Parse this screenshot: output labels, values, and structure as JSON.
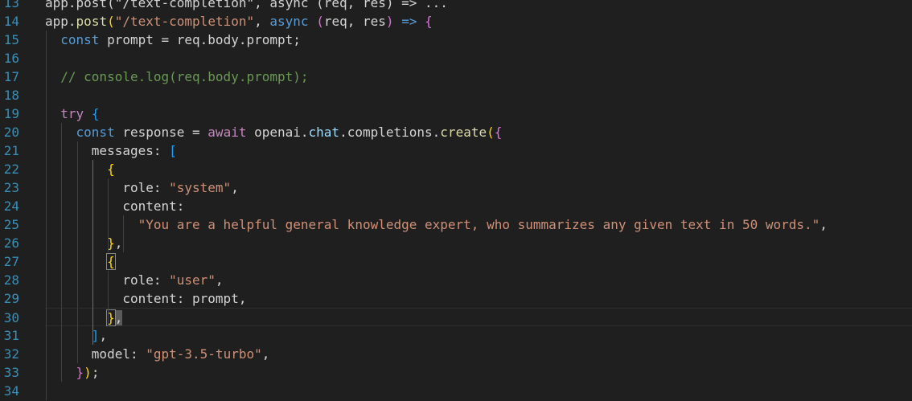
{
  "editor": {
    "lines": [
      {
        "num": "13",
        "tokens": [
          {
            "t": "app.post",
            "c": "t-plain"
          },
          {
            "t": "(\"/text-completion\", async (req, res) => ...",
            "c": "t-plain"
          }
        ]
      },
      {
        "num": "14",
        "tokens": [
          {
            "t": "app",
            "c": "t-plain"
          },
          {
            "t": ".",
            "c": "t-plain"
          },
          {
            "t": "post",
            "c": "t-func"
          },
          {
            "t": "(",
            "c": "t-paren1"
          },
          {
            "t": "\"/text-completion\"",
            "c": "t-string"
          },
          {
            "t": ", ",
            "c": "t-plain"
          },
          {
            "t": "async",
            "c": "t-keyword"
          },
          {
            "t": " ",
            "c": "t-plain"
          },
          {
            "t": "(",
            "c": "t-paren2"
          },
          {
            "t": "req",
            "c": "t-plain"
          },
          {
            "t": ", ",
            "c": "t-plain"
          },
          {
            "t": "res",
            "c": "t-plain"
          },
          {
            "t": ")",
            "c": "t-paren2"
          },
          {
            "t": " ",
            "c": "t-plain"
          },
          {
            "t": "=>",
            "c": "t-keyword"
          },
          {
            "t": " ",
            "c": "t-plain"
          },
          {
            "t": "{",
            "c": "t-paren2"
          }
        ]
      },
      {
        "num": "15",
        "tokens": [
          {
            "t": "  ",
            "c": "t-plain"
          },
          {
            "t": "const",
            "c": "t-keyword"
          },
          {
            "t": " prompt = req.",
            "c": "t-plain"
          },
          {
            "t": "body",
            "c": "t-plain"
          },
          {
            "t": ".prompt;",
            "c": "t-plain"
          }
        ]
      },
      {
        "num": "16",
        "tokens": []
      },
      {
        "num": "17",
        "tokens": [
          {
            "t": "  ",
            "c": "t-plain"
          },
          {
            "t": "// console.log(req.body.prompt);",
            "c": "t-comment"
          }
        ]
      },
      {
        "num": "18",
        "tokens": []
      },
      {
        "num": "19",
        "tokens": [
          {
            "t": "  ",
            "c": "t-plain"
          },
          {
            "t": "try",
            "c": "t-control"
          },
          {
            "t": " ",
            "c": "t-plain"
          },
          {
            "t": "{",
            "c": "t-paren3"
          }
        ]
      },
      {
        "num": "20",
        "tokens": [
          {
            "t": "    ",
            "c": "t-plain"
          },
          {
            "t": "const",
            "c": "t-keyword"
          },
          {
            "t": " response = ",
            "c": "t-plain"
          },
          {
            "t": "await",
            "c": "t-control"
          },
          {
            "t": " openai.",
            "c": "t-plain"
          },
          {
            "t": "chat",
            "c": "t-var"
          },
          {
            "t": ".completions.",
            "c": "t-plain"
          },
          {
            "t": "create",
            "c": "t-func"
          },
          {
            "t": "(",
            "c": "t-paren1"
          },
          {
            "t": "{",
            "c": "t-paren2"
          }
        ]
      },
      {
        "num": "21",
        "tokens": [
          {
            "t": "      messages: ",
            "c": "t-plain"
          },
          {
            "t": "[",
            "c": "t-paren3"
          }
        ]
      },
      {
        "num": "22",
        "tokens": [
          {
            "t": "        ",
            "c": "t-plain"
          },
          {
            "t": "{",
            "c": "t-paren1"
          }
        ]
      },
      {
        "num": "23",
        "tokens": [
          {
            "t": "          role: ",
            "c": "t-plain"
          },
          {
            "t": "\"system\"",
            "c": "t-string"
          },
          {
            "t": ",",
            "c": "t-plain"
          }
        ]
      },
      {
        "num": "24",
        "tokens": [
          {
            "t": "          content:",
            "c": "t-plain"
          }
        ]
      },
      {
        "num": "25",
        "tokens": [
          {
            "t": "            ",
            "c": "t-plain"
          },
          {
            "t": "\"You are a helpful general knowledge expert, who summarizes any given text in 50 words.\"",
            "c": "t-string"
          },
          {
            "t": ",",
            "c": "t-plain"
          }
        ]
      },
      {
        "num": "26",
        "tokens": [
          {
            "t": "        ",
            "c": "t-plain"
          },
          {
            "t": "}",
            "c": "t-paren1"
          },
          {
            "t": ",",
            "c": "t-plain"
          }
        ]
      },
      {
        "num": "27",
        "tokens": [
          {
            "t": "        ",
            "c": "t-plain"
          },
          {
            "t": "{",
            "c": "t-match"
          }
        ]
      },
      {
        "num": "28",
        "tokens": [
          {
            "t": "          role: ",
            "c": "t-plain"
          },
          {
            "t": "\"user\"",
            "c": "t-string"
          },
          {
            "t": ",",
            "c": "t-plain"
          }
        ]
      },
      {
        "num": "29",
        "tokens": [
          {
            "t": "          content: prompt,",
            "c": "t-plain"
          }
        ]
      },
      {
        "num": "30",
        "tokens": [
          {
            "t": "        ",
            "c": "t-plain"
          },
          {
            "t": "}",
            "c": "t-match"
          },
          {
            "t": ",",
            "c": "t-cursor"
          }
        ],
        "current": true
      },
      {
        "num": "31",
        "tokens": [
          {
            "t": "      ",
            "c": "t-plain"
          },
          {
            "t": "]",
            "c": "t-paren3"
          },
          {
            "t": ",",
            "c": "t-plain"
          }
        ]
      },
      {
        "num": "32",
        "tokens": [
          {
            "t": "      model: ",
            "c": "t-plain"
          },
          {
            "t": "\"gpt-3.5-turbo\"",
            "c": "t-string"
          },
          {
            "t": ",",
            "c": "t-plain"
          }
        ]
      },
      {
        "num": "33",
        "tokens": [
          {
            "t": "    ",
            "c": "t-plain"
          },
          {
            "t": "}",
            "c": "t-paren2"
          },
          {
            "t": ")",
            "c": "t-paren1"
          },
          {
            "t": ";",
            "c": "t-plain"
          }
        ]
      },
      {
        "num": "34",
        "tokens": []
      }
    ]
  },
  "colors": {
    "background": "#1f1f1f",
    "line_number": "#3a8fb8"
  }
}
